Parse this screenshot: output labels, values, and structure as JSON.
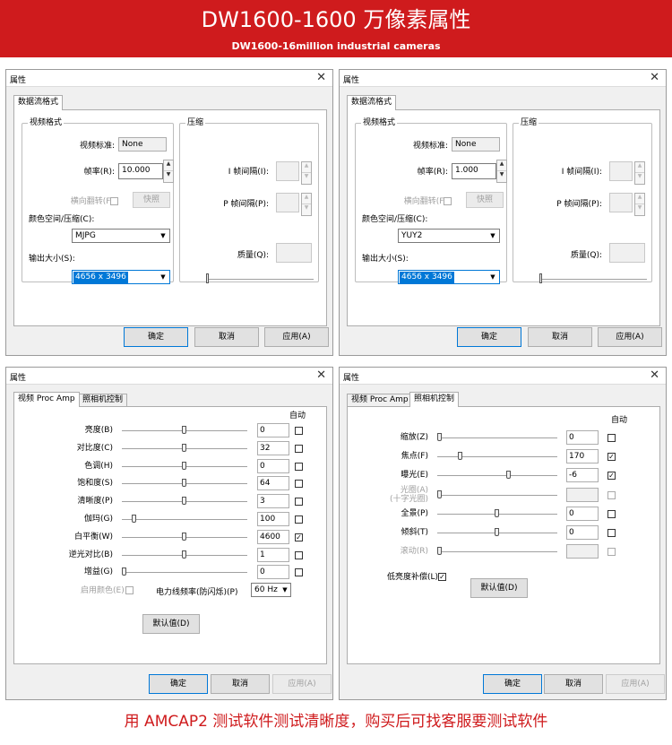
{
  "banner": {
    "title": "DW1600-1600 万像素属性",
    "subtitle": "DW1600-16million industrial cameras"
  },
  "footer": {
    "text": "用 AMCAP2 测试软件测试清晰度，购买后可找客服要测试软件"
  },
  "common": {
    "window_title": "属性",
    "close": "✕",
    "ok": "确定",
    "cancel": "取消",
    "apply": "应用(A)",
    "default": "默认值(D)",
    "up": "▲",
    "down": "▼",
    "arrow": "▼",
    "check": "✓"
  },
  "stream1": {
    "tab": "数据流格式",
    "video_group": "视频格式",
    "compress_group": "压缩",
    "video_standard_label": "视频标准:",
    "video_standard": "None",
    "frame_rate_label": "帧率(R):",
    "frame_rate": "10.000",
    "flip_label": "横向翻转(F):",
    "snapshot": "快照",
    "color_space_label": "颜色空间/压缩(C):",
    "color_space": "MJPG",
    "output_size_label": "输出大小(S):",
    "output_size": "4656 x 3496",
    "i_frame_label": "I 帧间隔(I):",
    "p_frame_label": "P 帧间隔(P):",
    "quality_label": "质量(Q):"
  },
  "stream2": {
    "tab": "数据流格式",
    "video_group": "视频格式",
    "compress_group": "压缩",
    "video_standard_label": "视频标准:",
    "video_standard": "None",
    "frame_rate_label": "帧率(R):",
    "frame_rate": "1.000",
    "flip_label": "横向翻转(F):",
    "snapshot": "快照",
    "color_space_label": "颜色空间/压缩(C):",
    "color_space": "YUY2",
    "output_size_label": "输出大小(S):",
    "output_size": "4656 x 3496",
    "i_frame_label": "I 帧间隔(I):",
    "p_frame_label": "P 帧间隔(P):",
    "quality_label": "质量(Q):"
  },
  "procamp": {
    "tabs": [
      "视频 Proc Amp",
      "照相机控制"
    ],
    "auto_label": "自动",
    "rows": [
      {
        "label": "亮度(B)",
        "value": "0",
        "level": 0.5,
        "auto": false
      },
      {
        "label": "对比度(C)",
        "value": "32",
        "level": 0.5,
        "auto": false
      },
      {
        "label": "色调(H)",
        "value": "0",
        "level": 0.5,
        "auto": false
      },
      {
        "label": "饱和度(S)",
        "value": "64",
        "level": 0.5,
        "auto": false
      },
      {
        "label": "清晰度(P)",
        "value": "3",
        "level": 0.5,
        "auto": false
      },
      {
        "label": "伽玛(G)",
        "value": "100",
        "level": 0.08,
        "auto": false
      },
      {
        "label": "白平衡(W)",
        "value": "4600",
        "level": 0.5,
        "auto": true
      },
      {
        "label": "逆光对比(B)",
        "value": "1",
        "level": 0.5,
        "auto": false
      },
      {
        "label": "增益(G)",
        "value": "0",
        "level": 0.0,
        "auto": false
      }
    ],
    "enable_color_label": "启用颜色(E)",
    "power_freq_label": "电力线频率(防闪烁)(P)",
    "power_freq": "60 Hz"
  },
  "camctrl": {
    "tabs": [
      "视频 Proc Amp",
      "照相机控制"
    ],
    "auto_label": "自动",
    "rows": [
      {
        "label": "缩放(Z)",
        "value": "0",
        "level": 0.0,
        "auto": false,
        "enabled": true
      },
      {
        "label": "焦点(F)",
        "value": "170",
        "level": 0.18,
        "auto": true,
        "enabled": true
      },
      {
        "label": "曝光(E)",
        "value": "-6",
        "level": 0.6,
        "auto": true,
        "enabled": true
      },
      {
        "label": "光圈(A)",
        "label2": "(十字光圈)",
        "value": "",
        "level": null,
        "auto": false,
        "enabled": false
      },
      {
        "label": "全景(P)",
        "value": "0",
        "level": 0.5,
        "auto": false,
        "enabled": true
      },
      {
        "label": "倾斜(T)",
        "value": "0",
        "level": 0.5,
        "auto": false,
        "enabled": true
      },
      {
        "label": "滚动(R)",
        "value": "",
        "level": null,
        "auto": false,
        "enabled": false
      }
    ],
    "low_light_label": "低亮度补偿(L)",
    "low_light": true
  }
}
